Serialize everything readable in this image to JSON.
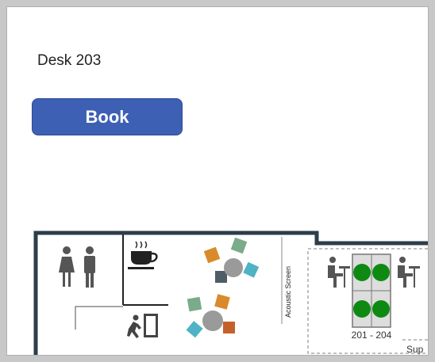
{
  "desk": {
    "title": "Desk 203"
  },
  "actions": {
    "book_label": "Book"
  },
  "floorplan": {
    "acoustic_screen_label": "Acoustic Screen",
    "desk_group_label": "201 - 204",
    "support_label": "Sup",
    "colors": {
      "wall": "#2c3e4a",
      "desk_available": "#0e8a12",
      "chair_orange": "#d98a2b",
      "chair_green": "#7aab8a",
      "chair_teal": "#4eb3c4",
      "chair_gray": "#4f5d66",
      "chair_rust": "#c4612b",
      "table_gray": "#9a9a9a",
      "icon_gray": "#555555"
    },
    "icons": [
      "restroom-icon",
      "coffee-cup-icon",
      "emergency-exit-icon",
      "person-at-desk-icon"
    ]
  }
}
